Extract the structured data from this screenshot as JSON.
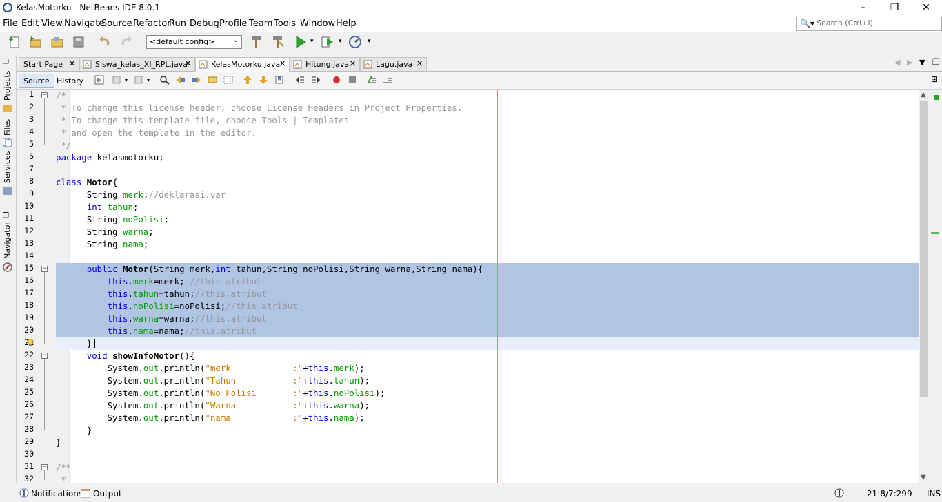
{
  "window": {
    "title": "KelasMotorku - NetBeans IDE 8.0.1"
  },
  "menu": [
    "File",
    "Edit",
    "View",
    "Navigate",
    "Source",
    "Refactor",
    "Run",
    "Debug",
    "Profile",
    "Team",
    "Tools",
    "Window",
    "Help"
  ],
  "search": {
    "placeholder": "Search (Ctrl+I)"
  },
  "toolbar": {
    "config": "<default config>"
  },
  "side_panels": [
    "Projects",
    "Files",
    "Services",
    "Navigator"
  ],
  "tabs": [
    {
      "label": "Start Page",
      "active": false
    },
    {
      "label": "Siswa_kelas_XI_RPL.java",
      "active": false
    },
    {
      "label": "KelasMotorku.java",
      "active": true
    },
    {
      "label": "Hitung.java",
      "active": false
    },
    {
      "label": "Lagu.java",
      "active": false
    }
  ],
  "editor_modes": {
    "source": "Source",
    "history": "History"
  },
  "code_lines": [
    {
      "n": "1",
      "html": "<span class='c'>/*</span>"
    },
    {
      "n": "2",
      "html": "<span class='c'> * To change this license header, choose License Headers in Project Properties.</span>"
    },
    {
      "n": "3",
      "html": "<span class='c'> * To change this template file, choose Tools | Templates</span>"
    },
    {
      "n": "4",
      "html": "<span class='c'> * and open the template in the editor.</span>"
    },
    {
      "n": "5",
      "html": "<span class='c'> */</span>"
    },
    {
      "n": "6",
      "html": "<span class='k'>package</span> kelasmotorku;"
    },
    {
      "n": "7",
      "html": ""
    },
    {
      "n": "8",
      "html": "<span class='k'>class</span> <span class='b'>Motor</span>{"
    },
    {
      "n": "9",
      "html": "      String <span class='f'>merk</span>;<span class='c'>//deklarasi.var</span>"
    },
    {
      "n": "10",
      "html": "      <span class='k'>int</span> <span class='f'>tahun</span>;"
    },
    {
      "n": "11",
      "html": "      String <span class='f'>noPolisi</span>;"
    },
    {
      "n": "12",
      "html": "      String <span class='f'>warna</span>;"
    },
    {
      "n": "13",
      "html": "      String <span class='f'>nama</span>;"
    },
    {
      "n": "14",
      "html": ""
    },
    {
      "n": "15",
      "html": "      <span class='k'>public</span> <span class='b'>Motor</span>(String merk,<span class='k'>int</span> tahun,String noPolisi,String warna,String nama){"
    },
    {
      "n": "16",
      "html": "          <span class='k'>this</span>.<span class='f'>merk</span>=merk; <span class='c'>//this.atribut</span>"
    },
    {
      "n": "17",
      "html": "          <span class='k'>this</span>.<span class='f'>tahun</span>=tahun;<span class='c'>//this.atribut</span>"
    },
    {
      "n": "18",
      "html": "          <span class='k'>this</span>.<span class='f'>noPolisi</span>=noPolisi;<span class='c'>//this.atribut</span>"
    },
    {
      "n": "19",
      "html": "          <span class='k'>this</span>.<span class='f'>warna</span>=warna;<span class='c'>//this.atribut</span>"
    },
    {
      "n": "20",
      "html": "          <span class='k'>this</span>.<span class='f'>nama</span>=nama;<span class='c'>//this.atribut</span>"
    },
    {
      "n": "21",
      "html": "      }"
    },
    {
      "n": "22",
      "html": "      <span class='k'>void</span> <span class='b'>showInfoMotor</span>(){"
    },
    {
      "n": "23",
      "html": "          System.<span class='f'>out</span>.println(<span class='s'>\"merk            :\"</span>+<span class='k'>this</span>.<span class='f'>merk</span>);"
    },
    {
      "n": "24",
      "html": "          System.<span class='f'>out</span>.println(<span class='s'>\"Tahun           :\"</span>+<span class='k'>this</span>.<span class='f'>tahun</span>);"
    },
    {
      "n": "25",
      "html": "          System.<span class='f'>out</span>.println(<span class='s'>\"No Polisi       :\"</span>+<span class='k'>this</span>.<span class='f'>noPolisi</span>);"
    },
    {
      "n": "26",
      "html": "          System.<span class='f'>out</span>.println(<span class='s'>\"Warna           :\"</span>+<span class='k'>this</span>.<span class='f'>warna</span>);"
    },
    {
      "n": "27",
      "html": "          System.<span class='f'>out</span>.println(<span class='s'>\"nama            :\"</span>+<span class='k'>this</span>.<span class='f'>nama</span>);"
    },
    {
      "n": "28",
      "html": "      }"
    },
    {
      "n": "29",
      "html": "}"
    },
    {
      "n": "30",
      "html": ""
    },
    {
      "n": "31",
      "html": "<span class='c'>/**</span>"
    },
    {
      "n": "32",
      "html": "<span class='c'> *</span>"
    }
  ],
  "selected_lines": [
    15,
    16,
    17,
    18,
    19,
    20
  ],
  "current_line": 21,
  "fold_markers": [
    1,
    15,
    22,
    31
  ],
  "statusbar": {
    "notifications": "Notifications",
    "output": "Output",
    "position": "21:8/7:299",
    "mode": "INS"
  }
}
